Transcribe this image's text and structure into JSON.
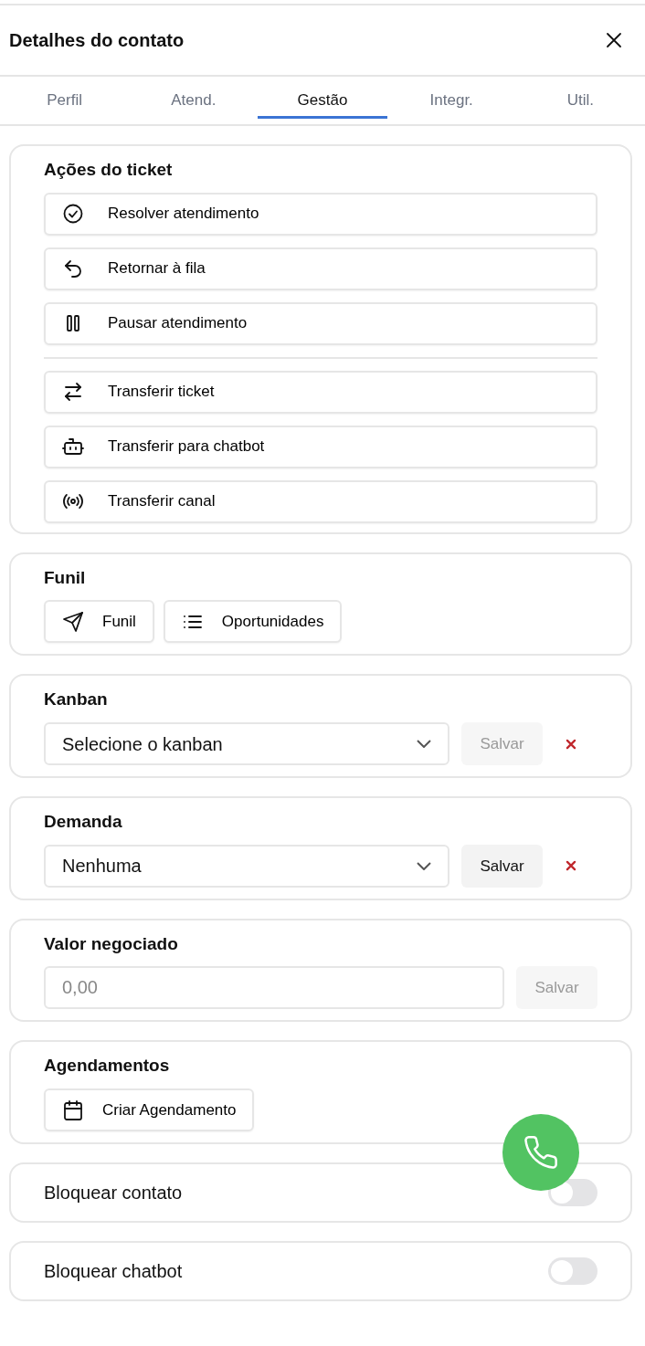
{
  "header": {
    "title": "Detalhes do contato"
  },
  "tabs": [
    {
      "label": "Perfil",
      "selected": false
    },
    {
      "label": "Atend.",
      "selected": false
    },
    {
      "label": "Gestão",
      "selected": true
    },
    {
      "label": "Integr.",
      "selected": false
    },
    {
      "label": "Util.",
      "selected": false
    }
  ],
  "sections": [
    {
      "kind": "actions",
      "title": "Ações do ticket",
      "groups": [
        [
          "Resolver atendimento",
          "Retornar à fila",
          "Pausar atendimento"
        ],
        [
          "Transferir ticket",
          "Transferir para chatbot",
          "Transferir canal"
        ]
      ]
    },
    {
      "kind": "buttons",
      "title": "Funil",
      "buttons": [
        "Funil",
        "Oportunidades"
      ]
    },
    {
      "kind": "select",
      "title": "Kanban",
      "value": "Selecione o kanban",
      "save": {
        "label": "Salvar",
        "disabled": true
      }
    },
    {
      "kind": "select",
      "title": "Demanda",
      "value": "Nenhuma",
      "save": {
        "label": "Salvar",
        "disabled": false
      }
    },
    {
      "kind": "input",
      "title": "Valor negociado",
      "placeholder": "0,00",
      "save": {
        "label": "Salvar",
        "disabled": true
      }
    },
    {
      "kind": "buttons",
      "title": "Agendamentos",
      "buttons": [
        "Criar Agendamento"
      ]
    },
    {
      "kind": "toggle",
      "label": "Bloquear contato",
      "on": false
    },
    {
      "kind": "toggle",
      "label": "Bloquear chatbot",
      "on": false
    }
  ]
}
